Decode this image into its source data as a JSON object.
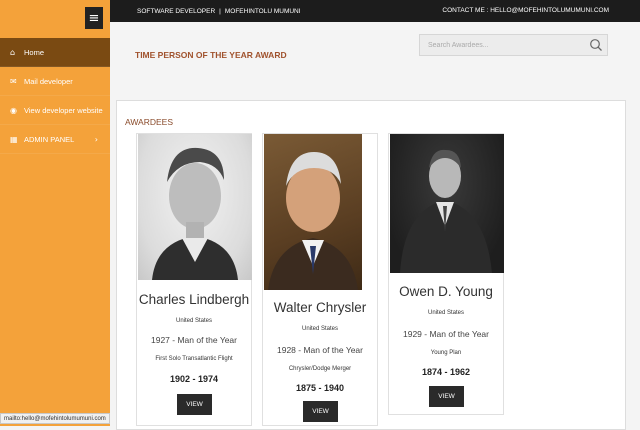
{
  "topbar": {
    "developer_label": "SOFTWARE DEVELOPER",
    "developer_name": "MOFEHINTOLU MUMUNI",
    "separator": "|",
    "contact": "CONTACT ME : HELLO@MOFEHINTOLUMUMUNI.COM"
  },
  "sidebar": {
    "toggle_icon": "menu-icon",
    "items": [
      {
        "label": "Home",
        "icon": "home-icon",
        "active": true
      },
      {
        "label": "Mail developer",
        "icon": "mail-icon",
        "active": false
      },
      {
        "label": "View developer website",
        "icon": "globe-icon",
        "active": false
      },
      {
        "label": "ADMIN PANEL",
        "icon": "table-icon",
        "active": false,
        "chevron": "›"
      }
    ]
  },
  "page_title": "TIME PERSON OF THE YEAR AWARD",
  "search": {
    "placeholder": "Search Awardees...",
    "icon": "search-icon"
  },
  "section_title": "AWARDEES",
  "awardees": [
    {
      "name": "Charles Lindbergh",
      "country": "United States",
      "award": "1927 - Man of the Year",
      "reason": "First Solo Transatlantic Flight",
      "years": "1902 - 1974",
      "button": "VIEW"
    },
    {
      "name": "Walter Chrysler",
      "country": "United States",
      "award": "1928 - Man of the Year",
      "reason": "Chrysler/Dodge Merger",
      "years": "1875 - 1940",
      "button": "VIEW"
    },
    {
      "name": "Owen D. Young",
      "country": "United States",
      "award": "1929 - Man of the Year",
      "reason": "Young Plan",
      "years": "1874 - 1962",
      "button": "VIEW"
    }
  ],
  "status_bar": "mailto:hello@mofehintolumumuni.com",
  "colors": {
    "sidebar": "#f4a23a",
    "active_nav": "#7a4a12",
    "topbar": "#1c1c1c",
    "accent": "#a0522d"
  }
}
